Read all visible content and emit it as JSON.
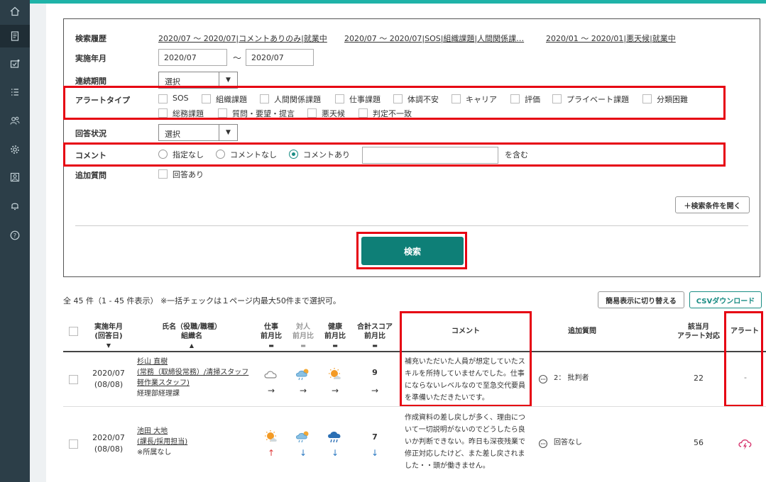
{
  "sidebar": {
    "items": [
      {
        "icon": "home-icon"
      },
      {
        "icon": "document-icon"
      },
      {
        "icon": "survey-icon"
      },
      {
        "icon": "list-icon"
      },
      {
        "icon": "users-icon"
      },
      {
        "icon": "gear-icon"
      },
      {
        "icon": "person-frame-icon"
      },
      {
        "icon": "bell-icon"
      },
      {
        "icon": "help-icon"
      }
    ]
  },
  "search": {
    "history_label": "検索履歴",
    "history_links": [
      "2020/07 ～ 2020/07|コメントありのみ|就業中",
      "2020/07 ～ 2020/07|SOS|組織課題|人間関係課…",
      "2020/01 ～ 2020/01|悪天候|就業中"
    ],
    "period_label": "実施年月",
    "period_from": "2020/07",
    "period_tilde": "～",
    "period_to": "2020/07",
    "continuous_label": "連続期間",
    "continuous_value": "選択",
    "alert_type_label": "アラートタイプ",
    "alert_types": [
      "SOS",
      "組織課題",
      "人間関係課題",
      "仕事課題",
      "体調不安",
      "キャリア",
      "評価",
      "プライベート課題",
      "分類困難",
      "総務課題",
      "質問・要望・提言",
      "悪天候",
      "判定不一致"
    ],
    "answer_status_label": "回答状況",
    "answer_status_value": "選択",
    "comment_label": "コメント",
    "comment_options": [
      "指定なし",
      "コメントなし",
      "コメントあり"
    ],
    "comment_input_value": "",
    "comment_suffix": "を含む",
    "extra_label": "追加質問",
    "extra_option": "回答あり",
    "open_conditions_button": "＋検索条件を開く",
    "search_button": "検索"
  },
  "results": {
    "summary": "全 45 件（1 - 45 件表示） ※一括チェックは１ページ内最大50件まで選択可。",
    "toggle_button": "簡易表示に切り替える",
    "csv_button": "CSVダウンロード",
    "headers": {
      "date": "実施年月\n(回答日)",
      "name": "氏名（役職/職種）\n組織名",
      "work": "仕事\n前月比",
      "person": "対人\n前月比",
      "health": "健康\n前月比",
      "total": "合計スコア\n前月比",
      "comment": "コメント",
      "extra": "追加質問",
      "alert_handling": "該当月\nアラート対応",
      "alert": "アラート"
    },
    "rows": [
      {
        "date": "2020/07",
        "answer_date": "(08/08)",
        "name": "杉山 直樹",
        "role": "(常務（取締役常務）/清掃スタッフ 軽作業スタッフ)",
        "org": "経理部経理課",
        "work_icon": "cloud-icon",
        "work_trend": "→",
        "person_icon": "cloud-sun-rain-icon",
        "person_trend": "→",
        "health_icon": "sun-cloud-icon",
        "health_trend": "→",
        "total": "9",
        "total_trend": "→",
        "comment": "補充いただいた人員が想定していたスキルを所持していませんでした。仕事にならないレベルなので至急交代要員を準備いただきたいです。",
        "extra": "2： 批判者",
        "alert_count": "22",
        "alert": "-"
      },
      {
        "date": "2020/07",
        "answer_date": "(08/08)",
        "name": "池田 大地",
        "role": "(課長/採用担当)",
        "org": "※所属なし",
        "work_icon": "sun-cloud-icon",
        "work_trend": "↑",
        "person_icon": "cloud-sun-rain-icon",
        "person_trend": "↓",
        "health_icon": "heavy-rain-icon",
        "health_trend": "↓",
        "total": "7",
        "total_trend": "↓",
        "comment": "作成資料の差し戻しが多く、理由について一切説明がないのでどうしたら良いか判断できない。昨日も深夜残業で修正対応したけど、また差し戻されました・・頭が働きません。",
        "extra": "回答なし",
        "alert_count": "56",
        "alert": "lightning-alert-icon"
      }
    ]
  },
  "colors": {
    "sidebar_bg": "#2c3e48",
    "accent": "#0e7f77",
    "topbar": "#1fb3a8",
    "highlight": "#e60012",
    "alert": "#d6336c"
  }
}
